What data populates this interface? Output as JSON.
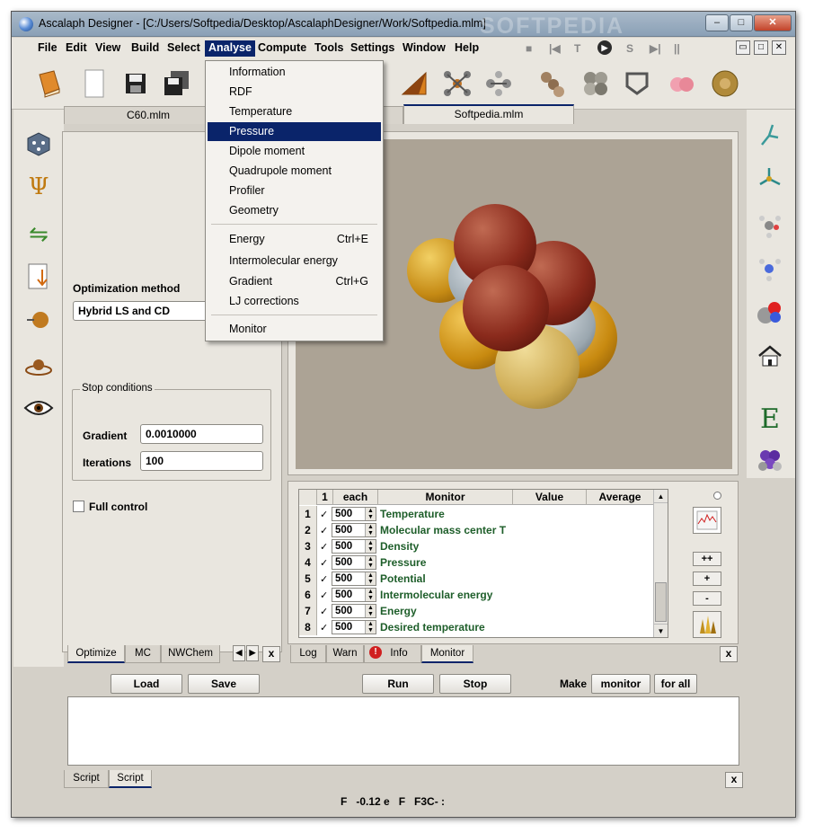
{
  "window": {
    "title": "Ascalaph Designer - [C:/Users/Softpedia/Desktop/AscalaphDesigner/Work/Softpedia.mlm]",
    "watermark": "SOFTPEDIA",
    "controls": {
      "minimize": "–",
      "maximize": "□",
      "close": "✕"
    }
  },
  "menubar": {
    "items": [
      "File",
      "Edit",
      "View",
      "Build",
      "Select",
      "Analyse",
      "Compute",
      "Tools",
      "Settings",
      "Window",
      "Help"
    ],
    "active": "Analyse",
    "sim_controls": [
      "■",
      "|◀",
      "T",
      "▶",
      "S",
      "▶|",
      "||"
    ],
    "mdi": [
      "▭",
      "□",
      "✕"
    ]
  },
  "analyse_menu": {
    "items": [
      {
        "label": "Information",
        "shortcut": ""
      },
      {
        "label": "RDF",
        "shortcut": ""
      },
      {
        "label": "Temperature",
        "shortcut": ""
      },
      {
        "label": "Pressure",
        "shortcut": ""
      },
      {
        "label": "Dipole moment",
        "shortcut": ""
      },
      {
        "label": "Quadrupole moment",
        "shortcut": ""
      },
      {
        "label": "Profiler",
        "shortcut": ""
      },
      {
        "label": "Geometry",
        "shortcut": ""
      },
      {
        "label": "Energy",
        "shortcut": "Ctrl+E"
      },
      {
        "label": "Intermolecular energy",
        "shortcut": ""
      },
      {
        "label": "Gradient",
        "shortcut": "Ctrl+G"
      },
      {
        "label": "LJ corrections",
        "shortcut": ""
      },
      {
        "label": "Monitor",
        "shortcut": ""
      }
    ],
    "highlighted": "Pressure"
  },
  "doc_tabs": [
    "C60.mlm",
    "Softpedia.mlm"
  ],
  "optimize_panel": {
    "method_label": "Optimization method",
    "method_value": "Hybrid LS and CD",
    "stop_conditions_label": "Stop conditions",
    "gradient_label": "Gradient",
    "gradient_value": "0.0010000",
    "iterations_label": "Iterations",
    "iterations_value": "100",
    "full_control_label": "Full control"
  },
  "left_tabs": [
    "Optimize",
    "MC",
    "NWChem"
  ],
  "monitor_table": {
    "header": [
      "1",
      "each",
      "Monitor",
      "Value",
      "Average"
    ],
    "rows": [
      {
        "n": "1",
        "each": "500",
        "name": "Temperature"
      },
      {
        "n": "2",
        "each": "500",
        "name": "Molecular mass center T"
      },
      {
        "n": "3",
        "each": "500",
        "name": "Density"
      },
      {
        "n": "4",
        "each": "500",
        "name": "Pressure"
      },
      {
        "n": "5",
        "each": "500",
        "name": "Potential"
      },
      {
        "n": "6",
        "each": "500",
        "name": "Intermolecular energy"
      },
      {
        "n": "7",
        "each": "500",
        "name": "Energy"
      },
      {
        "n": "8",
        "each": "500",
        "name": "Desired temperature"
      }
    ],
    "side_buttons": [
      "++",
      "+",
      "-"
    ]
  },
  "log_tabs": [
    "Log",
    "Warn",
    "Info",
    "Monitor"
  ],
  "script_bar": {
    "load": "Load",
    "save": "Save",
    "run": "Run",
    "stop": "Stop",
    "make_label": "Make",
    "monitor": "monitor",
    "for_all": "for all"
  },
  "script_tabs": [
    "Script",
    "Script"
  ],
  "status": {
    "text": "F   -0.12 e   F   F3C- :"
  },
  "colors": {
    "selection": "#0a246a",
    "scene_bg": "#aca395",
    "monitor_text": "#1e5e2a"
  }
}
